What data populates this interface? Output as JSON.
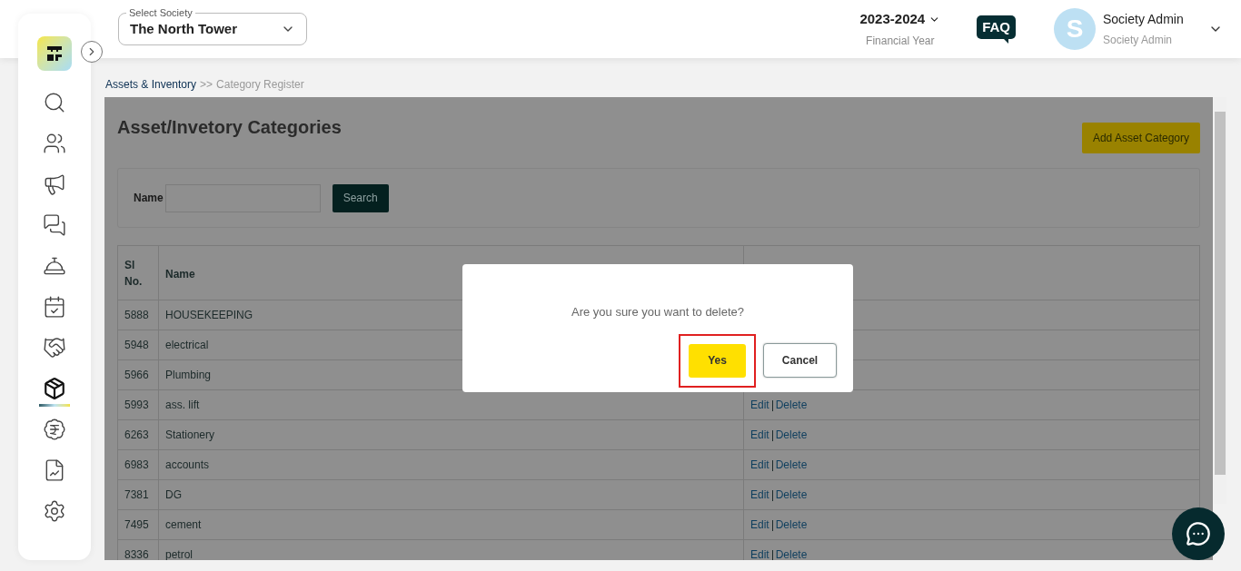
{
  "header": {
    "society_select": {
      "label": "Select Society",
      "value": "The North Tower"
    },
    "financial_year": {
      "value": "2023-2024",
      "label": "Financial Year"
    },
    "faq": "FAQ",
    "user": {
      "initial": "S",
      "name": "Society Admin",
      "role": "Society Admin"
    }
  },
  "sidebar": {
    "items": [
      {
        "selected": false
      },
      {
        "selected": false
      },
      {
        "selected": false
      },
      {
        "selected": false
      },
      {
        "selected": false
      },
      {
        "selected": false
      },
      {
        "selected": false
      },
      {
        "selected": true
      },
      {
        "selected": false
      },
      {
        "selected": false
      },
      {
        "selected": false
      }
    ]
  },
  "breadcrumb": {
    "link": "Assets & Inventory",
    "separator": ">>",
    "current": "Category Register"
  },
  "page": {
    "title": "Asset/Invetory Categories",
    "add_button": "Add Asset Category",
    "filter": {
      "label": "Name",
      "button": "Search"
    }
  },
  "table": {
    "columns": [
      "Sl No.",
      "Name"
    ],
    "rows": [
      {
        "sl": "5888",
        "name": "HOUSEKEEPING",
        "actions": []
      },
      {
        "sl": "5948",
        "name": "electrical",
        "actions": []
      },
      {
        "sl": "5966",
        "name": "Plumbing",
        "actions": []
      },
      {
        "sl": "5993",
        "name": "ass. lift",
        "actions": [
          "Edit",
          "Delete"
        ]
      },
      {
        "sl": "6263",
        "name": "Stationery",
        "actions": [
          "Edit",
          "Delete"
        ]
      },
      {
        "sl": "6983",
        "name": "accounts",
        "actions": [
          "Edit",
          "Delete"
        ]
      },
      {
        "sl": "7381",
        "name": "DG",
        "actions": [
          "Edit",
          "Delete"
        ]
      },
      {
        "sl": "7495",
        "name": "cement",
        "actions": [
          "Edit",
          "Delete"
        ]
      },
      {
        "sl": "8336",
        "name": "petrol",
        "actions": [
          "Edit",
          "Delete"
        ]
      }
    ]
  },
  "dialog": {
    "message": "Are you sure you want to delete?",
    "confirm": "Yes",
    "cancel": "Cancel",
    "confirm_highlighted": true
  }
}
